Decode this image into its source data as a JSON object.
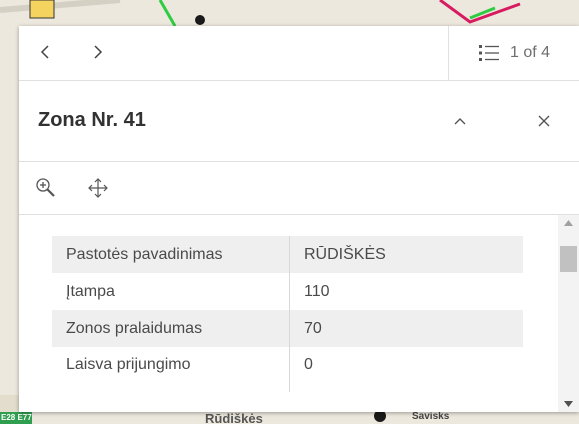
{
  "popup": {
    "pager": {
      "text": "1 of 4"
    },
    "title": "Zona Nr. 41",
    "attributes": [
      {
        "key": "Pastotės pavadinimas",
        "value": "RŪDIŠKĖS"
      },
      {
        "key": "Įtampa",
        "value": "110"
      },
      {
        "key": "Zonos pralaidumas",
        "value": "70"
      },
      {
        "key": "Laisva prijungimo",
        "value": "0"
      }
    ]
  },
  "map": {
    "labels": [
      "Rūdiškės",
      "Savisks",
      "E28 E77"
    ]
  }
}
